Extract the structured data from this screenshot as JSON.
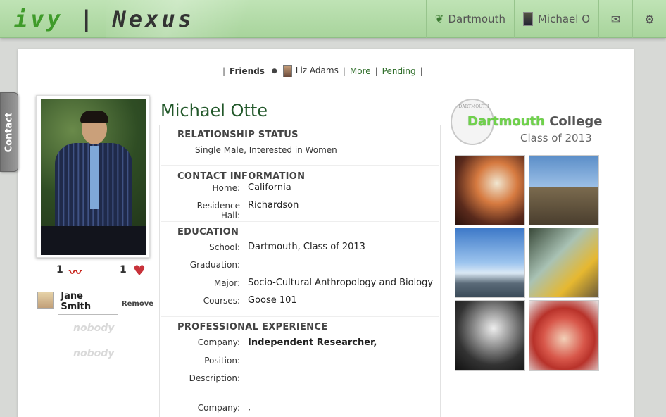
{
  "header": {
    "logo": {
      "ivy": "ivy",
      "bar": "|",
      "nexus": "Nexus"
    },
    "college_link": "Dartmouth",
    "user_name": "Michael O",
    "mail_icon": "envelope-icon",
    "settings_icon": "gear-icon"
  },
  "side_tab": {
    "label": "Contact"
  },
  "friends_bar": {
    "sep_left": "|",
    "friends_label": "Friends",
    "dot": "●",
    "friend_name": "Liz Adams",
    "sep1": "|",
    "more_label": "More",
    "sep2": "|",
    "pending_label": "Pending",
    "sep3": "|"
  },
  "profile": {
    "name": "Michael Otte",
    "pepper_count": "1",
    "heart_count": "1",
    "relationship_person": "Jane Smith",
    "remove_label": "Remove",
    "nobody_1": "nobody",
    "nobody_2": "nobody"
  },
  "relationship_status": {
    "title": "RELATIONSHIP STATUS",
    "text": "Single Male, Interested in Women"
  },
  "contact_info": {
    "title": "CONTACT INFORMATION",
    "home_label": "Home:",
    "home_value": "California",
    "hall_label": "Residence Hall:",
    "hall_value": "Richardson"
  },
  "education": {
    "title": "EDUCATION",
    "school_label": "School:",
    "school_value": "Dartmouth, Class of 2013",
    "graduation_label": "Graduation:",
    "graduation_value": "",
    "major_label": "Major:",
    "major_value": "Socio-Cultural Anthropology and Biology",
    "courses_label": "Courses:",
    "courses_value": "Goose 101"
  },
  "professional": {
    "title": "PROFESSIONAL EXPERIENCE",
    "company_label": "Company:",
    "company_value": "Independent Researcher,",
    "position_label": "Position:",
    "description_label": "Description:",
    "company2_label": "Company:",
    "company2_value": ","
  },
  "college": {
    "seal_text": "DARTMOUTH",
    "name_green": "Dartmouth",
    "name_rest": " College",
    "class": "Class of 2013"
  },
  "icons": {
    "pepper": "chili-pepper-icon",
    "heart": "heart-icon",
    "college": "leaf-icon"
  }
}
